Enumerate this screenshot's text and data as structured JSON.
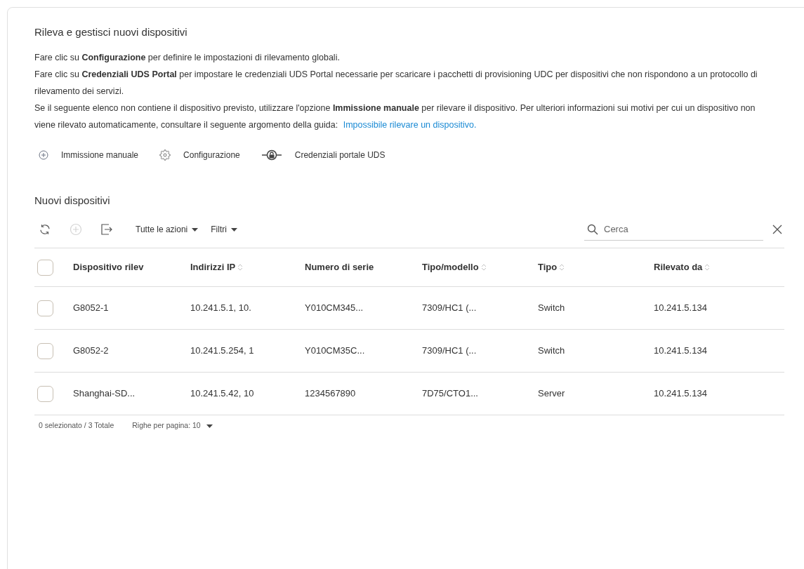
{
  "title": "Rileva e gestisci nuovi dispositivi",
  "paragraphs": [
    "Fare clic su **Configurazione** per definire le impostazioni di rilevamento globali.",
    "Fare clic su **Credenziali UDS Portal** per impostare le credenziali UDS Portal necessarie per scaricare i pacchetti di provisioning UDC per dispositivi che non rispondono a un protocollo di rilevamento dei servizi.",
    "Se il seguente elenco non contiene il dispositivo previsto, utilizzare l'opzione **Immissione manuale** per rilevare il dispositivo. Per ulteriori informazioni sui motivi per cui un dispositivo non viene rilevato automaticamente, consultare il seguente argomento della guida: "
  ],
  "help_link": "Impossibile rilevare un dispositivo.",
  "actions": [
    {
      "kind": "add",
      "label": "Immissione manuale"
    },
    {
      "kind": "gear",
      "label": "Configurazione"
    },
    {
      "kind": "lock",
      "label": "Credenziali portale UDS"
    }
  ],
  "section_title": "Nuovi dispositivi",
  "toolbar": {
    "icon_buttons": [
      {
        "kind": "refresh",
        "disabled": false
      },
      {
        "kind": "add",
        "disabled": true
      },
      {
        "kind": "export",
        "disabled": false
      }
    ],
    "menus": [
      "Tutte le azioni",
      "Filtri"
    ],
    "search": {
      "placeholder": "Cerca"
    }
  },
  "table": {
    "header_checked": false,
    "columns": [
      {
        "label": "Dispositivo rilev",
        "sortable": false
      },
      {
        "label": "Indirizzi IP",
        "sortable": true
      },
      {
        "label": "Numero di serie",
        "sortable": false
      },
      {
        "label": "Tipo/modello",
        "sortable": true
      },
      {
        "label": "Tipo",
        "sortable": true
      },
      {
        "label": "Rilevato da",
        "sortable": true
      }
    ],
    "rows": [
      {
        "checked": false,
        "cells": [
          "G8052-1",
          "10.241.5.1, 10.",
          "Y010CM345...",
          "7309/HC1 (...",
          "Switch",
          "10.241.5.134"
        ]
      },
      {
        "checked": false,
        "cells": [
          "G8052-2",
          "10.241.5.254, 1",
          "Y010CM35C...",
          "7309/HC1 (...",
          "Switch",
          "10.241.5.134"
        ]
      },
      {
        "checked": false,
        "cells": [
          "Shanghai-SD...",
          "10.241.5.42, 10",
          "1234567890",
          "7D75/CTO1...",
          "Server",
          "10.241.5.134"
        ]
      }
    ]
  },
  "footer": {
    "summary": "0 selezionato / 3 Totale",
    "rows_per_page": "Righe per pagina: 10"
  }
}
